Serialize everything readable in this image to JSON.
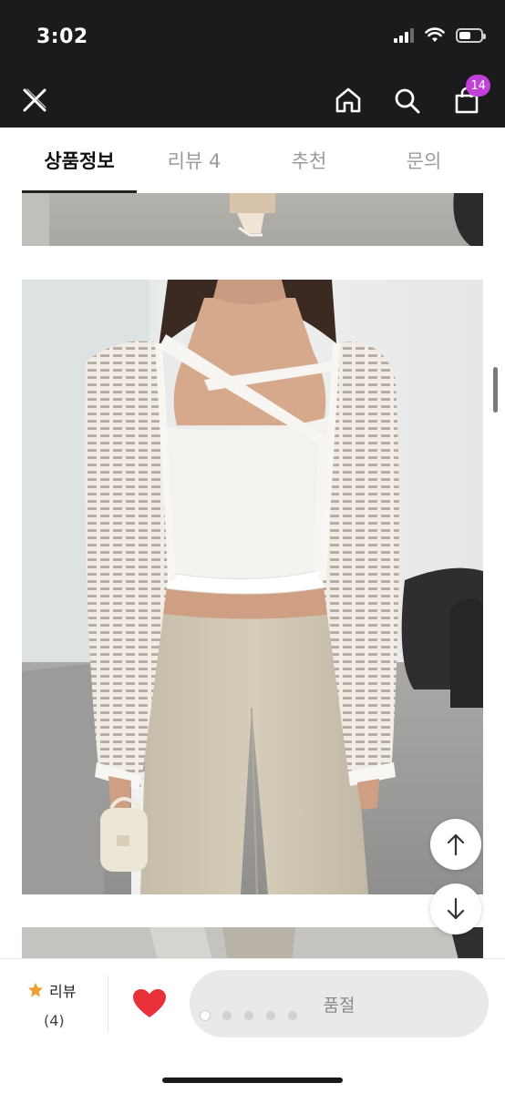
{
  "status_bar": {
    "time": "3:02",
    "battery_level": 0.55
  },
  "header": {
    "cart_count": "14",
    "badge_color": "#c040d8"
  },
  "tabs": [
    {
      "label": "상품정보",
      "active": true
    },
    {
      "label": "리뷰 4",
      "active": false
    },
    {
      "label": "추천",
      "active": false
    },
    {
      "label": "문의",
      "active": false
    }
  ],
  "content": {
    "images": [
      "product-detail-photo-top",
      "product-detail-photo-main",
      "product-detail-photo-bottom"
    ]
  },
  "floating": {
    "up_icon": "arrow-up-icon",
    "down_icon": "arrow-down-icon"
  },
  "bottom_bar": {
    "review_label": "리뷰",
    "review_count": "(4)",
    "like_color": "#e8303a",
    "star_color": "#f0a030",
    "soldout_label": "품절",
    "pager_total": 5,
    "pager_current": 1
  }
}
